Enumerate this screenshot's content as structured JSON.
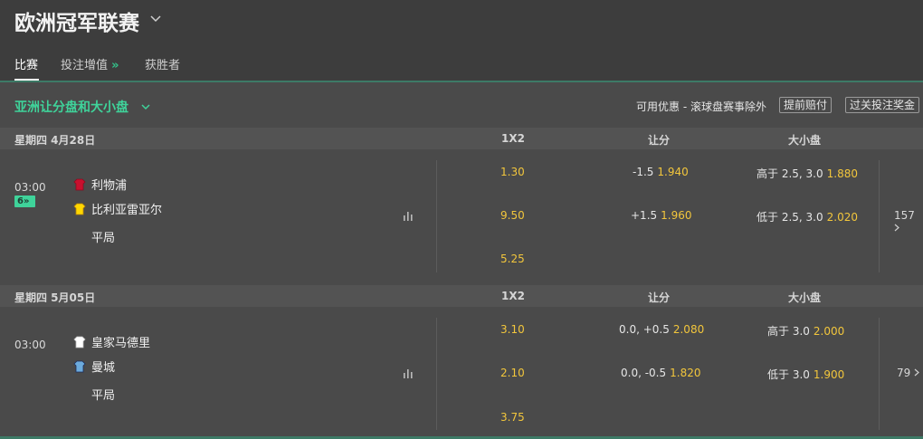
{
  "header": {
    "title": "欧洲冠军联赛",
    "tabs": [
      {
        "label": "比赛"
      },
      {
        "label": "投注增值"
      },
      {
        "label": "获胜者"
      }
    ],
    "boost_arrow": "»"
  },
  "market": {
    "title": "亚洲让分盘和大小盘",
    "promo_text": "可用优惠 - 滚球盘赛事除外",
    "early_payout": "提前赔付",
    "acca_bonus": "过关投注奖金"
  },
  "columns": {
    "col_1x2": "1X2",
    "col_handicap": "让分",
    "col_total": "大小盘"
  },
  "days": [
    {
      "date": "星期四 4月28日",
      "match": {
        "time": "03:00",
        "live_count": "6",
        "live_arrow": "»",
        "home": "利物浦",
        "away": "比利亚雷亚尔",
        "draw": "平局",
        "odds_home": "1.30",
        "odds_away": "9.50",
        "odds_draw": "5.25",
        "hcp_home_line": "-1.5",
        "hcp_home_odds": "1.940",
        "hcp_away_line": "+1.5",
        "hcp_away_odds": "1.960",
        "over_line": "高于 2.5, 3.0",
        "over_odds": "1.880",
        "under_line": "低于 2.5, 3.0",
        "under_odds": "2.020",
        "more_markets": "157",
        "home_colors": {
          "shirt": "#c8102e",
          "trim": "#8b0a1f"
        },
        "away_colors": {
          "shirt": "#ffd700",
          "trim": "#b8860b"
        }
      }
    },
    {
      "date": "星期四 5月05日",
      "match": {
        "time": "03:00",
        "home": "皇家马德里",
        "away": "曼城",
        "draw": "平局",
        "odds_home": "3.10",
        "odds_away": "2.10",
        "odds_draw": "3.75",
        "hcp_home_line": "0.0, +0.5",
        "hcp_home_odds": "2.080",
        "hcp_away_line": "0.0, -0.5",
        "hcp_away_odds": "1.820",
        "over_line": "高于 3.0",
        "over_odds": "2.000",
        "under_line": "低于 3.0",
        "under_odds": "1.900",
        "more_markets": "79",
        "home_colors": {
          "shirt": "#ffffff",
          "trim": "#bbbbbb"
        },
        "away_colors": {
          "shirt": "#6cabdd",
          "trim": "#1c2c5b"
        }
      }
    }
  ],
  "colors": {
    "accent_green": "#3fd39a",
    "odds_yellow": "#f2c63c",
    "background": "#3d3d3d",
    "row_bg": "#4a4a4a"
  },
  "icons": {
    "title_chevron": "chevron-down-icon",
    "market_chevron": "chevron-down-icon",
    "stats": "bar-chart-icon",
    "more_arrow": "chevron-right-icon",
    "jersey": "jersey-icon"
  }
}
